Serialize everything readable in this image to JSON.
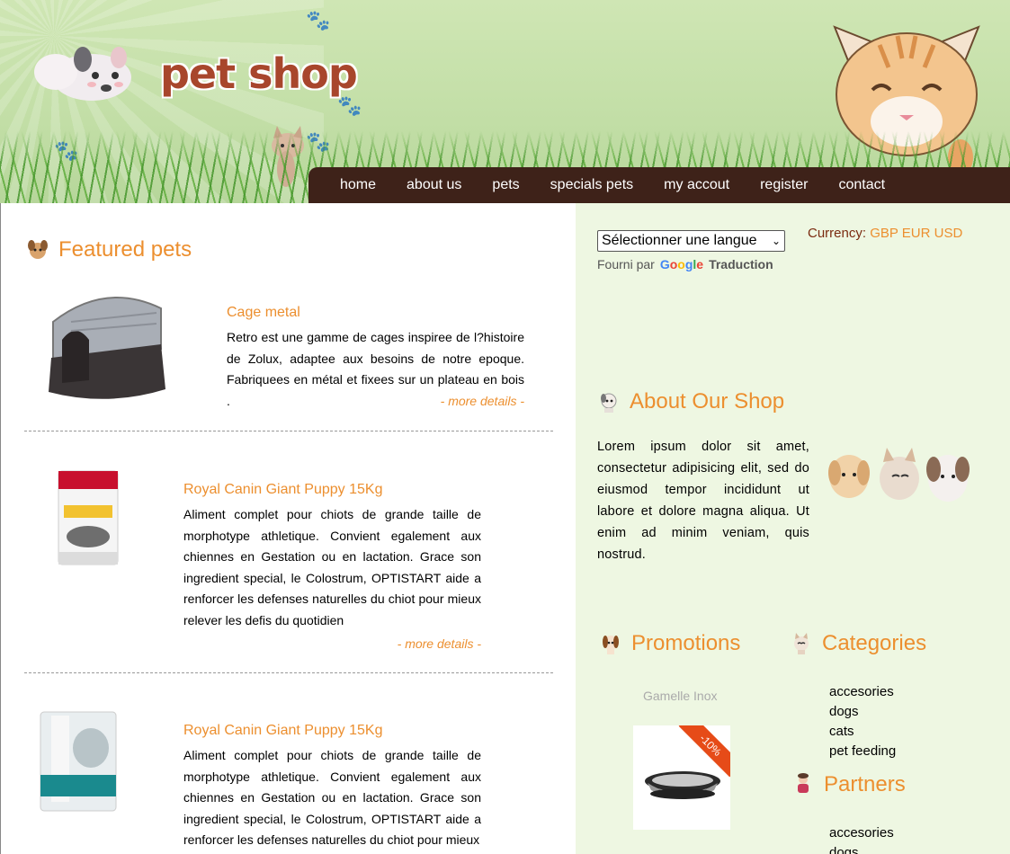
{
  "header": {
    "logo_text": "pet shop"
  },
  "nav": {
    "items": [
      "home",
      "about us",
      "pets",
      "specials pets",
      "my accout",
      "register",
      "contact"
    ]
  },
  "featured": {
    "title": "Featured pets",
    "products": [
      {
        "name": "Cage metal",
        "description": "Retro est une gamme de cages inspiree de l?histoire de Zolux, adaptee aux besoins de notre epoque. Fabriquees en métal et fixees sur un plateau en bois .",
        "more": "- more details -"
      },
      {
        "name": "Royal Canin Giant Puppy 15Kg",
        "description": "Aliment complet pour chiots de grande taille de morphotype athletique. Convient egalement aux chiennes en Gestation ou en lactation. Grace son ingredient special, le Colostrum, OPTISTART aide a renforcer les defenses naturelles du chiot pour mieux relever les defis du quotidien",
        "more": "- more details -"
      },
      {
        "name": "Royal Canin Giant Puppy 15Kg",
        "description": "Aliment complet pour chiots de grande taille de morphotype athletique. Convient egalement aux chiennes en Gestation ou en lactation. Grace son ingredient special, le Colostrum, OPTISTART aide a renforcer les defenses naturelles du chiot pour mieux"
      }
    ]
  },
  "translate": {
    "select_label": "Sélectionner une langue",
    "powered_by": "Fourni par",
    "google": "Google",
    "translation": "Traduction"
  },
  "currency": {
    "label": "Currency:",
    "options": [
      "GBP",
      "EUR",
      "USD"
    ]
  },
  "about": {
    "title": "About Our Shop",
    "text": "Lorem ipsum dolor sit amet, consectetur adipisicing elit, sed do eiusmod tempor incididunt ut labore et dolore magna aliqua. Ut enim ad minim veniam, quis nostrud."
  },
  "promotions": {
    "title": "Promotions",
    "item_name": "Gamelle Inox",
    "discount": "-10%"
  },
  "categories": {
    "title": "Categories",
    "items": [
      "accesories",
      "dogs",
      "cats",
      "pet feeding"
    ]
  },
  "partners": {
    "title": "Partners",
    "items": [
      "accesories",
      "dogs"
    ]
  },
  "colors": {
    "accent": "#ec8f2f",
    "nav_bg": "#3e2219",
    "right_bg": "#eef7e2",
    "header_bg": "#c2dea6"
  }
}
